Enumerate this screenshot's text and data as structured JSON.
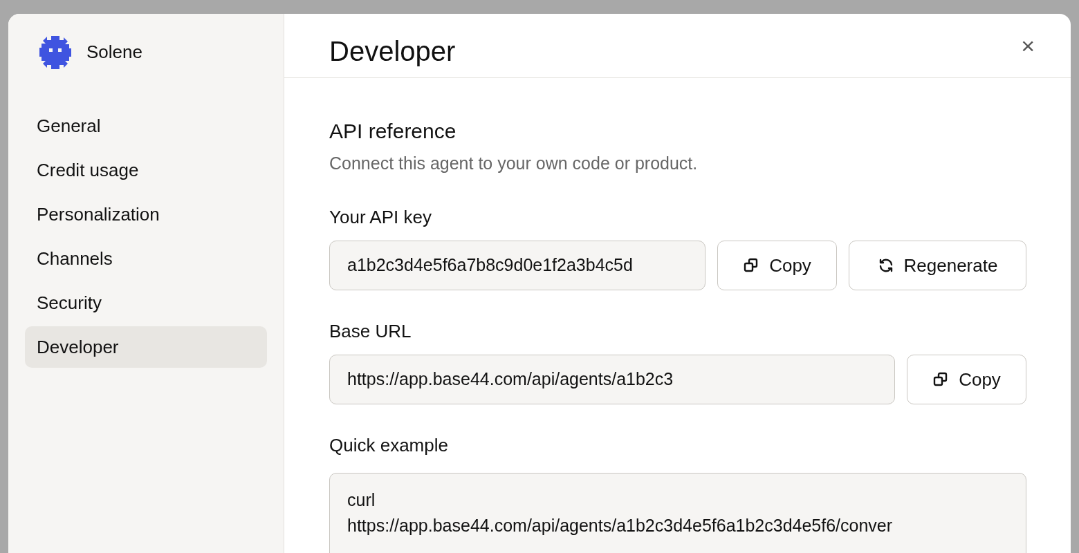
{
  "brand": {
    "name": "Solene"
  },
  "sidebar": {
    "items": [
      {
        "label": "General",
        "selected": false
      },
      {
        "label": "Credit usage",
        "selected": false
      },
      {
        "label": "Personalization",
        "selected": false
      },
      {
        "label": "Channels",
        "selected": false
      },
      {
        "label": "Security",
        "selected": false
      },
      {
        "label": "Developer",
        "selected": true
      }
    ]
  },
  "header": {
    "title": "Developer",
    "close": "×"
  },
  "section": {
    "title": "API reference",
    "description": "Connect this agent to your own code or product."
  },
  "api_key": {
    "label": "Your API key",
    "value": "a1b2c3d4e5f6a7b8c9d0e1f2a3b4c5d",
    "buttons": [
      {
        "kind": "copy",
        "label": "Copy"
      },
      {
        "kind": "regenerate",
        "label": "Regenerate"
      }
    ]
  },
  "base_url": {
    "label": "Base URL",
    "value": "https://app.base44.com/api/agents/a1b2c3",
    "buttons": [
      {
        "kind": "copy",
        "label": "Copy"
      }
    ]
  },
  "quick_example": {
    "label": "Quick example",
    "lines": [
      "curl",
      "https://app.base44.com/api/agents/a1b2c3d4e5f6a1b2c3d4e5f6/conver"
    ]
  }
}
